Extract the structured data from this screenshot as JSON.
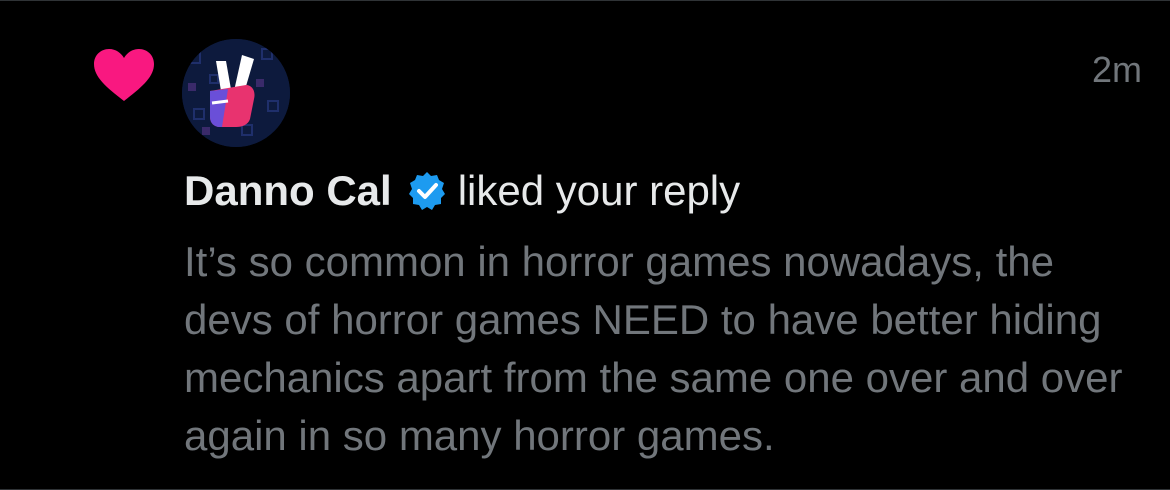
{
  "notification": {
    "type_icon": "heart-icon",
    "avatar_icon": "peace-hand-icon",
    "timestamp": "2m",
    "user_name": "Danno Cal",
    "verified_icon": "verified-badge-icon",
    "action_text": "liked your reply",
    "reply_text": "It’s so common in horror games nowadays, the devs of horror games NEED to have better hiding mechanics apart from the same one over and over again in so many horror games."
  },
  "colors": {
    "background": "#000000",
    "heart": "#f91880",
    "verified": "#1d9bf0",
    "primary_text": "#e7e9ea",
    "secondary_text": "#71767b"
  }
}
